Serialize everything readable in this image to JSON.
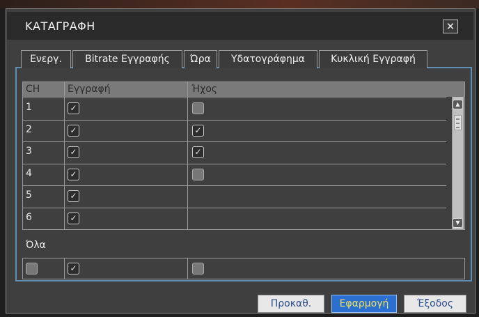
{
  "window": {
    "title": "ΚΑΤΑΓΡΑΦΗ",
    "close_glyph": "✕"
  },
  "tabs": [
    {
      "label": "Ενεργ.",
      "active": true
    },
    {
      "label": "Bitrate Εγγραφής",
      "active": false
    },
    {
      "label": "Ώρα",
      "active": false
    },
    {
      "label": "Υδατογράφημα",
      "active": false
    },
    {
      "label": "Κυκλική Εγγραφή",
      "active": false
    }
  ],
  "table": {
    "columns": [
      "CH",
      "Εγγραφή",
      "Ήχος"
    ],
    "rows": [
      {
        "ch": "1",
        "record": true,
        "audio": false
      },
      {
        "ch": "2",
        "record": true,
        "audio": true
      },
      {
        "ch": "3",
        "record": true,
        "audio": true
      },
      {
        "ch": "4",
        "record": true,
        "audio": false
      },
      {
        "ch": "5",
        "record": true,
        "audio": null
      },
      {
        "ch": "6",
        "record": true,
        "audio": null
      }
    ]
  },
  "all": {
    "label": "Όλα",
    "select_all": false,
    "record": true,
    "audio": false
  },
  "buttons": {
    "defaults": "Προκαθ.",
    "apply": "Εφαρμογή",
    "exit": "Έξοδος"
  },
  "colors": {
    "accent": "#2b63a8",
    "panel_border": "#5f8fb5",
    "apply_text": "#f0e05c"
  }
}
